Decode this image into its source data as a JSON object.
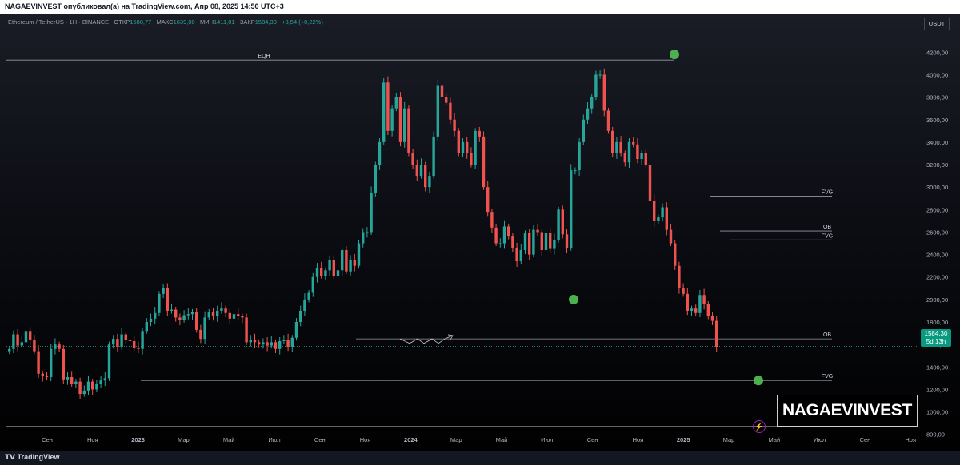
{
  "header": {
    "published": "NAGAEVINVEST опубликовал(а) на TradingView.com, Апр 08, 2025 14:50 UTC+3"
  },
  "legend": {
    "symbol": "Ethereum / TetherUS · 1Н · BINANCE",
    "open_label": "ОТКР",
    "open": "1580,77",
    "high_label": "МАКС",
    "high": "1639,00",
    "low_label": "МИН",
    "low": "1411,01",
    "close_label": "ЗАКР",
    "close": "1584,30",
    "change": "+3,54 (+0,22%)"
  },
  "currency_button": "USDT",
  "last_price": {
    "value": "1584,30",
    "countdown": "5d 13h"
  },
  "brand": "NAGAEVINVEST",
  "footer": {
    "logo_text": "TradingView"
  },
  "colors": {
    "up": "#26a69a",
    "down": "#ef5350",
    "level_line": "#9598a1",
    "marker": "#4caf50",
    "price_tag": "#089981"
  },
  "chart_data": {
    "type": "candlestick",
    "title": "",
    "x_tick_labels": [
      "Сен",
      "Ноя",
      "2023",
      "Мар",
      "Май",
      "Июл",
      "Сен",
      "Ноя",
      "2024",
      "Мар",
      "Май",
      "Июл",
      "Сен",
      "Ноя",
      "2025",
      "Мар",
      "Май",
      "Июл",
      "Сен",
      "Ноя"
    ],
    "y_tick_labels": [
      "4200,00",
      "4000,00",
      "3800,00",
      "3600,00",
      "3400,00",
      "3200,00",
      "3000,00",
      "2800,00",
      "2600,00",
      "2400,00",
      "2200,00",
      "2000,00",
      "1800,00",
      "1600,00",
      "1400,00",
      "1200,00",
      "1000,00",
      "800,00"
    ],
    "y_ticks": [
      4200,
      4000,
      3800,
      3600,
      3400,
      3200,
      3000,
      2800,
      2600,
      2400,
      2200,
      2000,
      1800,
      1600,
      1400,
      1200,
      1000,
      800
    ],
    "ylim": [
      720,
      4380
    ],
    "current_price": 1584.3,
    "grid": false,
    "weekly_closes": [
      1560,
      1690,
      1590,
      1620,
      1720,
      1640,
      1540,
      1340,
      1320,
      1310,
      1560,
      1600,
      1560,
      1290,
      1310,
      1250,
      1270,
      1160,
      1190,
      1270,
      1200,
      1250,
      1280,
      1300,
      1600,
      1650,
      1580,
      1690,
      1640,
      1630,
      1570,
      1560,
      1720,
      1800,
      1830,
      1880,
      2050,
      2100,
      1900,
      1910,
      1840,
      1820,
      1860,
      1870,
      1890,
      1730,
      1650,
      1840,
      1890,
      1850,
      1900,
      1920,
      1880,
      1830,
      1870,
      1850,
      1840,
      1620,
      1640,
      1620,
      1600,
      1620,
      1590,
      1620,
      1560,
      1630,
      1640,
      1580,
      1660,
      1800,
      1900,
      2000,
      2060,
      2200,
      2280,
      2210,
      2260,
      2350,
      2210,
      2260,
      2440,
      2250,
      2350,
      2300,
      2500,
      2600,
      2600,
      2950,
      3200,
      3400,
      3930,
      3500,
      3700,
      3800,
      3400,
      3700,
      3300,
      3200,
      3100,
      3200,
      3000,
      3100,
      3450,
      3900,
      3800,
      3750,
      3600,
      3500,
      3300,
      3400,
      3300,
      3200,
      3500,
      3450,
      3000,
      2780,
      2640,
      2500,
      2500,
      2650,
      2560,
      2460,
      2340,
      2440,
      2590,
      2400,
      2620,
      2600,
      2440,
      2590,
      2450,
      2530,
      2800,
      2580,
      2460,
      3150,
      3150,
      3400,
      3600,
      3700,
      3800,
      4000,
      4000,
      3680,
      3500,
      3300,
      3400,
      3300,
      3220,
      3400,
      3380,
      3250,
      3300,
      3200,
      2880,
      2700,
      2730,
      2820,
      2620,
      2500,
      2300,
      2100,
      2050,
      1900,
      1920,
      1880,
      2040,
      1960,
      1850,
      1810,
      1580
    ],
    "annotations": [
      {
        "label": "EQH",
        "price": 4130
      },
      {
        "label": "FVG",
        "price": 2920
      },
      {
        "label": "OB",
        "price": 2610
      },
      {
        "label": "FVG",
        "price": 2530
      },
      {
        "label": "OB",
        "price": 1650
      },
      {
        "label": "FVG",
        "price": 1280
      }
    ]
  }
}
